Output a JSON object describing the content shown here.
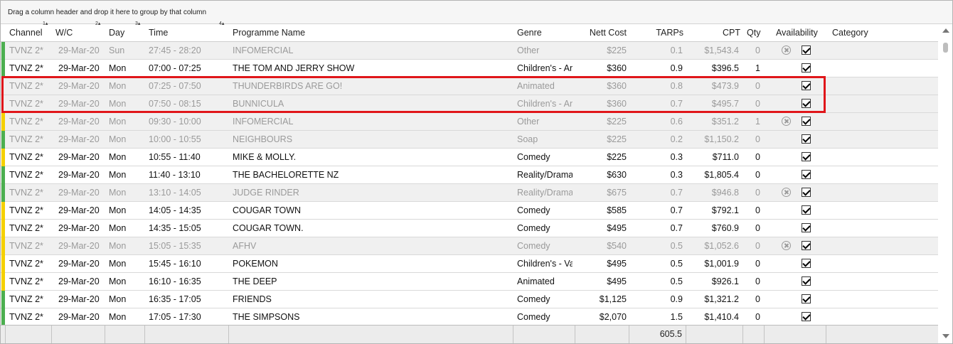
{
  "group_panel": {
    "hint": "Drag a column header and drop it here to group by that column"
  },
  "columns": {
    "channel": "Channel",
    "wc": "W/C",
    "day": "Day",
    "time": "Time",
    "programme": "Programme Name",
    "genre": "Genre",
    "nett_cost": "Nett Cost",
    "tarps": "TARPs",
    "cpt": "CPT",
    "qty": "Qty",
    "availability": "Availability",
    "category": "Category"
  },
  "sort_indicators": {
    "channel": "1▴",
    "wc": "2▴",
    "day": "3▴",
    "time": "4▴"
  },
  "colors": {
    "green": "#4caf50",
    "yellow": "#f5d000",
    "highlight": "#e0161a"
  },
  "rows": [
    {
      "strip": "green",
      "dim": true,
      "channel": "TVNZ 2*",
      "wc": "29-Mar-20",
      "day": "Sun",
      "time": "27:45 - 28:20",
      "programme": "INFOMERCIAL",
      "genre": "Other",
      "nett": "$225",
      "tarps": "0.1",
      "cpt": "$1,543.4",
      "qty": "0",
      "x": true,
      "avail": true
    },
    {
      "strip": "green",
      "dim": false,
      "channel": "TVNZ 2*",
      "wc": "29-Mar-20",
      "day": "Mon",
      "time": "07:00 - 07:25",
      "programme": "THE TOM AND JERRY SHOW",
      "genre": "Children's - An",
      "nett": "$360",
      "tarps": "0.9",
      "cpt": "$396.5",
      "qty": "1",
      "x": false,
      "avail": true
    },
    {
      "strip": "none",
      "dim": true,
      "channel": "TVNZ 2*",
      "wc": "29-Mar-20",
      "day": "Mon",
      "time": "07:25 - 07:50",
      "programme": "THUNDERBIRDS ARE GO!",
      "genre": "Animated",
      "nett": "$360",
      "tarps": "0.8",
      "cpt": "$473.9",
      "qty": "0",
      "x": false,
      "avail": true
    },
    {
      "strip": "none",
      "dim": true,
      "channel": "TVNZ 2*",
      "wc": "29-Mar-20",
      "day": "Mon",
      "time": "07:50 - 08:15",
      "programme": "BUNNICULA",
      "genre": "Children's - An",
      "nett": "$360",
      "tarps": "0.7",
      "cpt": "$495.7",
      "qty": "0",
      "x": false,
      "avail": true
    },
    {
      "strip": "yellow",
      "dim": true,
      "channel": "TVNZ 2*",
      "wc": "29-Mar-20",
      "day": "Mon",
      "time": "09:30 - 10:00",
      "programme": "INFOMERCIAL",
      "genre": "Other",
      "nett": "$225",
      "tarps": "0.6",
      "cpt": "$351.2",
      "qty": "1",
      "x": true,
      "avail": true
    },
    {
      "strip": "green",
      "dim": true,
      "channel": "TVNZ 2*",
      "wc": "29-Mar-20",
      "day": "Mon",
      "time": "10:00 - 10:55",
      "programme": "NEIGHBOURS",
      "genre": "Soap",
      "nett": "$225",
      "tarps": "0.2",
      "cpt": "$1,150.2",
      "qty": "0",
      "x": false,
      "avail": true
    },
    {
      "strip": "yellow",
      "dim": false,
      "channel": "TVNZ 2*",
      "wc": "29-Mar-20",
      "day": "Mon",
      "time": "10:55 - 11:40",
      "programme": "MIKE & MOLLY.",
      "genre": "Comedy",
      "nett": "$225",
      "tarps": "0.3",
      "cpt": "$711.0",
      "qty": "0",
      "x": false,
      "avail": true
    },
    {
      "strip": "green",
      "dim": false,
      "channel": "TVNZ 2*",
      "wc": "29-Mar-20",
      "day": "Mon",
      "time": "11:40 - 13:10",
      "programme": "THE BACHELORETTE NZ",
      "genre": "Reality/Drama",
      "nett": "$630",
      "tarps": "0.3",
      "cpt": "$1,805.4",
      "qty": "0",
      "x": false,
      "avail": true
    },
    {
      "strip": "green",
      "dim": true,
      "channel": "TVNZ 2*",
      "wc": "29-Mar-20",
      "day": "Mon",
      "time": "13:10 - 14:05",
      "programme": "JUDGE RINDER",
      "genre": "Reality/Drama",
      "nett": "$675",
      "tarps": "0.7",
      "cpt": "$946.8",
      "qty": "0",
      "x": true,
      "avail": true
    },
    {
      "strip": "yellow",
      "dim": false,
      "channel": "TVNZ 2*",
      "wc": "29-Mar-20",
      "day": "Mon",
      "time": "14:05 - 14:35",
      "programme": "COUGAR TOWN",
      "genre": "Comedy",
      "nett": "$585",
      "tarps": "0.7",
      "cpt": "$792.1",
      "qty": "0",
      "x": false,
      "avail": true
    },
    {
      "strip": "yellow",
      "dim": false,
      "channel": "TVNZ 2*",
      "wc": "29-Mar-20",
      "day": "Mon",
      "time": "14:35 - 15:05",
      "programme": "COUGAR TOWN.",
      "genre": "Comedy",
      "nett": "$495",
      "tarps": "0.7",
      "cpt": "$760.9",
      "qty": "0",
      "x": false,
      "avail": true
    },
    {
      "strip": "yellow",
      "dim": true,
      "channel": "TVNZ 2*",
      "wc": "29-Mar-20",
      "day": "Mon",
      "time": "15:05 - 15:35",
      "programme": "AFHV",
      "genre": "Comedy",
      "nett": "$540",
      "tarps": "0.5",
      "cpt": "$1,052.6",
      "qty": "0",
      "x": true,
      "avail": true
    },
    {
      "strip": "yellow",
      "dim": false,
      "channel": "TVNZ 2*",
      "wc": "29-Mar-20",
      "day": "Mon",
      "time": "15:45 - 16:10",
      "programme": "POKEMON",
      "genre": "Children's - Va",
      "nett": "$495",
      "tarps": "0.5",
      "cpt": "$1,001.9",
      "qty": "0",
      "x": false,
      "avail": true
    },
    {
      "strip": "yellow",
      "dim": false,
      "channel": "TVNZ 2*",
      "wc": "29-Mar-20",
      "day": "Mon",
      "time": "16:10 - 16:35",
      "programme": "THE DEEP",
      "genre": "Animated",
      "nett": "$495",
      "tarps": "0.5",
      "cpt": "$926.1",
      "qty": "0",
      "x": false,
      "avail": true
    },
    {
      "strip": "green",
      "dim": false,
      "channel": "TVNZ 2*",
      "wc": "29-Mar-20",
      "day": "Mon",
      "time": "16:35 - 17:05",
      "programme": "FRIENDS",
      "genre": "Comedy",
      "nett": "$1,125",
      "tarps": "0.9",
      "cpt": "$1,321.2",
      "qty": "0",
      "x": false,
      "avail": true
    },
    {
      "strip": "green",
      "dim": false,
      "channel": "TVNZ 2*",
      "wc": "29-Mar-20",
      "day": "Mon",
      "time": "17:05 - 17:30",
      "programme": "THE SIMPSONS",
      "genre": "Comedy",
      "nett": "$2,070",
      "tarps": "1.5",
      "cpt": "$1,410.4",
      "qty": "0",
      "x": false,
      "avail": true
    }
  ],
  "footer": {
    "tarps_total": "605.5"
  }
}
